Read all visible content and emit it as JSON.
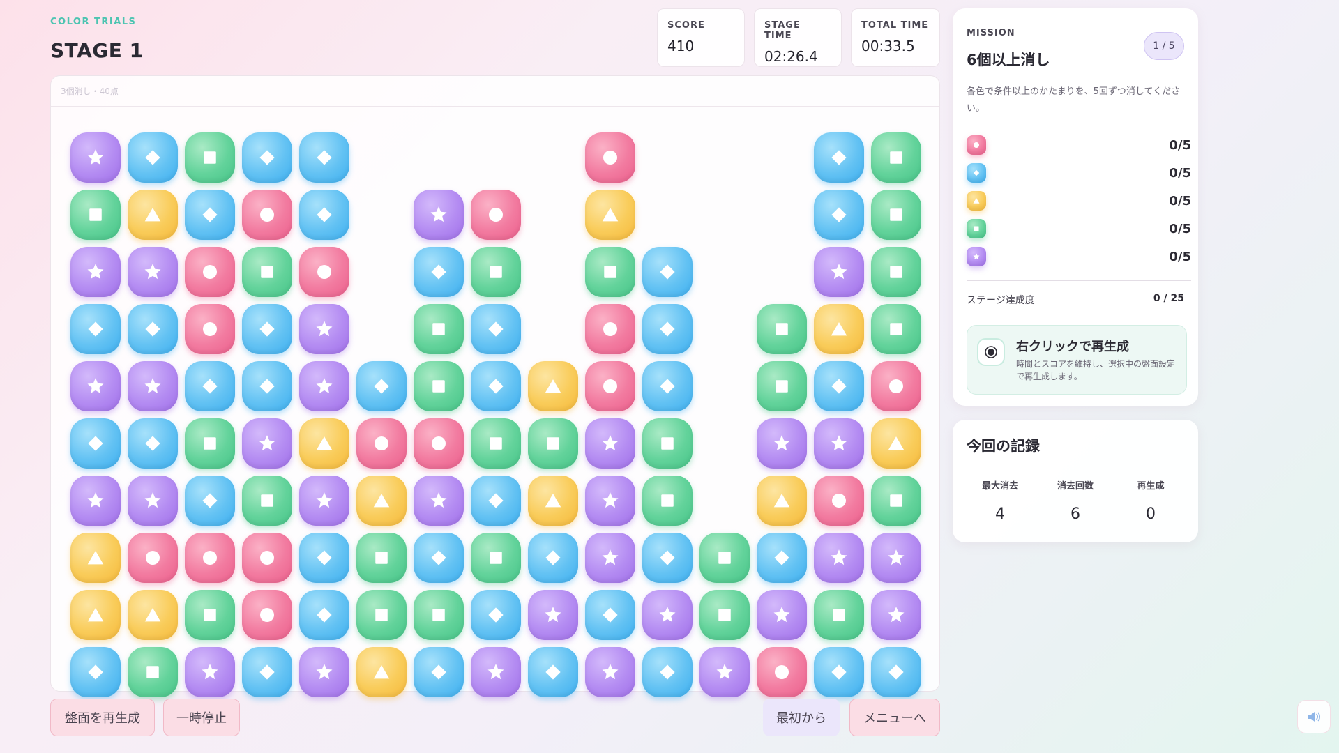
{
  "header": {
    "brand": "COLOR TRIALS",
    "stage_title": "STAGE 1"
  },
  "stats": {
    "score_label": "SCORE",
    "score_value": "410",
    "stage_time_label": "STAGE TIME",
    "stage_time_value": "02:26.4",
    "total_time_label": "TOTAL TIME",
    "total_time_value": "00:33.5"
  },
  "board": {
    "status_text": "3個消し・40点",
    "columns": [
      [
        "B",
        "Y",
        "Y",
        "P",
        "B",
        "P",
        "B",
        "P",
        "G",
        "P"
      ],
      [
        "G",
        "Y",
        "R",
        "P",
        "B",
        "P",
        "B",
        "P",
        "Y",
        "B"
      ],
      [
        "P",
        "G",
        "R",
        "B",
        "G",
        "B",
        "R",
        "R",
        "B",
        "G"
      ],
      [
        "B",
        "R",
        "R",
        "G",
        "P",
        "B",
        "B",
        "G",
        "R",
        "B"
      ],
      [
        "P",
        "B",
        "B",
        "P",
        "Y",
        "P",
        "P",
        "R",
        "B",
        "B"
      ],
      [
        "Y",
        "G",
        "G",
        "Y",
        "R",
        "B"
      ],
      [
        "B",
        "G",
        "B",
        "P",
        "R",
        "G",
        "G",
        "B",
        "P"
      ],
      [
        "P",
        "B",
        "G",
        "B",
        "G",
        "B",
        "B",
        "G",
        "R"
      ],
      [
        "B",
        "P",
        "B",
        "Y",
        "G",
        "Y"
      ],
      [
        "P",
        "B",
        "P",
        "P",
        "P",
        "R",
        "R",
        "G",
        "Y",
        "R"
      ],
      [
        "B",
        "P",
        "B",
        "G",
        "G",
        "B",
        "B",
        "B"
      ],
      [
        "P",
        "G",
        "G"
      ],
      [
        "R",
        "P",
        "B",
        "Y",
        "P",
        "G",
        "G"
      ],
      [
        "B",
        "G",
        "P",
        "R",
        "P",
        "B",
        "Y",
        "P",
        "B",
        "B"
      ],
      [
        "B",
        "P",
        "P",
        "G",
        "Y",
        "R",
        "G",
        "G",
        "G",
        "G"
      ]
    ],
    "legend": {
      "P": {
        "color": "purple",
        "icon": "star-icon"
      },
      "B": {
        "color": "blue",
        "icon": "diamond-icon"
      },
      "Y": {
        "color": "yellow",
        "icon": "triangle-icon"
      },
      "G": {
        "color": "green",
        "icon": "square-icon"
      },
      "R": {
        "color": "pink",
        "icon": "circle-icon"
      }
    }
  },
  "buttons": {
    "regenerate": "盤面を再生成",
    "pause": "一時停止",
    "restart": "最初から",
    "menu": "メニューへ"
  },
  "mission": {
    "label": "MISSION",
    "title": "6個以上消し",
    "badge": "1 / 5",
    "description": "各色で条件以上のかたまりを、5回ずつ消してください。",
    "items": [
      {
        "color": "pink",
        "icon": "circle-icon",
        "count": "0/5"
      },
      {
        "color": "blue",
        "icon": "diamond-icon",
        "count": "0/5"
      },
      {
        "color": "yellow",
        "icon": "triangle-icon",
        "count": "0/5"
      },
      {
        "color": "green",
        "icon": "square-icon",
        "count": "0/5"
      },
      {
        "color": "purple",
        "icon": "star-icon",
        "count": "0/5"
      }
    ],
    "progress_label": "ステージ達成度",
    "progress_value": "0 / 25",
    "regen_title": "右クリックで再生成",
    "regen_desc": "時間とスコアを維持し、選択中の盤面設定で再生成します。"
  },
  "record": {
    "title": "今回の記録",
    "max_clear_label": "最大消去",
    "max_clear_value": "4",
    "clear_count_label": "消去回数",
    "clear_count_value": "6",
    "regen_label": "再生成",
    "regen_value": "0"
  },
  "colors": {
    "accent_teal": "#4cc4b1",
    "purple": "#b48cf2",
    "blue": "#63c2f3",
    "yellow": "#f9cc5a",
    "green": "#63d39b",
    "pink": "#f27ba0"
  }
}
